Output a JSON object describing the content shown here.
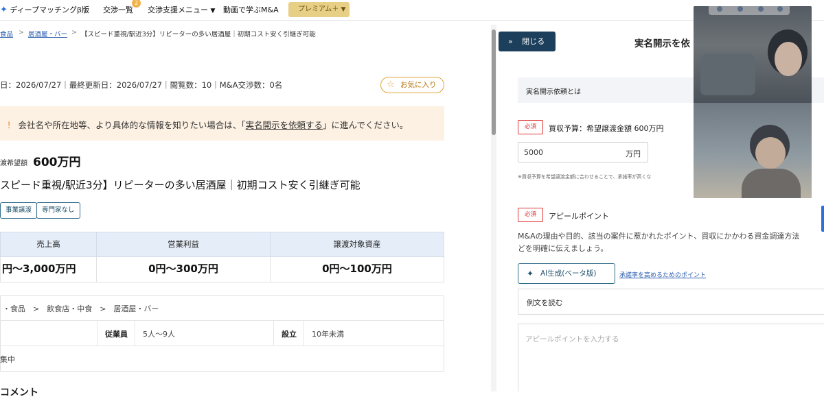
{
  "topnav": {
    "items": [
      {
        "label": "ディープマッチングβ版"
      },
      {
        "label": "交渉一覧",
        "badge": "2"
      },
      {
        "label": "交渉支援メニュー"
      },
      {
        "label": "動画で学ぶM&A"
      }
    ],
    "premium_label": "プレミアム＋"
  },
  "breadcrumb": {
    "items": [
      "食品",
      "居酒屋・バー"
    ],
    "current": "【スピード重視/駅近3分】リピーターの多い居酒屋｜初期コスト安く引継ぎ可能"
  },
  "listing": {
    "meta": "日：2026/07/27｜最終更新日：2026/07/27｜閲覧数：10｜M&A交渉数：0名",
    "favorite_label": "お気に入り",
    "notice_prefix": "会社名や所在地等、より具体的な情報を知りたい場合は、「",
    "notice_link": "実名開示を依頼する",
    "notice_suffix": "」に進んでください。",
    "price_label": "渡希望額",
    "price_value": "600万円",
    "title": "スピード重視/駅近3分】リピーターの多い居酒屋｜初期コスト安く引継ぎ可能",
    "tags": [
      "事業譲渡",
      "専門家なし"
    ],
    "financials": {
      "headers": [
        "売上高",
        "営業利益",
        "譲渡対象資産"
      ],
      "values": [
        "円〜3,000万円",
        "0円〜300万円",
        "0円〜100万円"
      ]
    },
    "category_path": "・食品　>　飲食店・中食　>　居酒屋・バー",
    "employees_label": "従業員",
    "employees_value": "5人〜9人",
    "established_label": "設立",
    "established_value": "10年未満",
    "extra_text": "集中",
    "bottom_heading": "コメント"
  },
  "panel": {
    "close_label": "閉じる",
    "title": "実名開示を依",
    "what_is_label": "実名開示依頼とは",
    "required_label": "必須",
    "budget_label": "買収予算：希望譲渡金額 600万円",
    "budget_value": "5000",
    "budget_unit": "万円",
    "budget_note": "※買収予算を希望譲渡金額に合わせることで、承諾率が高くな",
    "appeal_label": "アピールポイント",
    "appeal_desc_1": "M&Aの理由や目的、該当の案件に惹かれたポイント、買収にかかわる資金調達方法",
    "appeal_desc_2": "どを明確に伝えましょう。",
    "ai_button_label": "AI生成(ベータ版)",
    "tip_link": "承諾率を高めるためのポイント",
    "example_label": "例文を読む",
    "appeal_placeholder": "アピールポイントを入力する"
  }
}
